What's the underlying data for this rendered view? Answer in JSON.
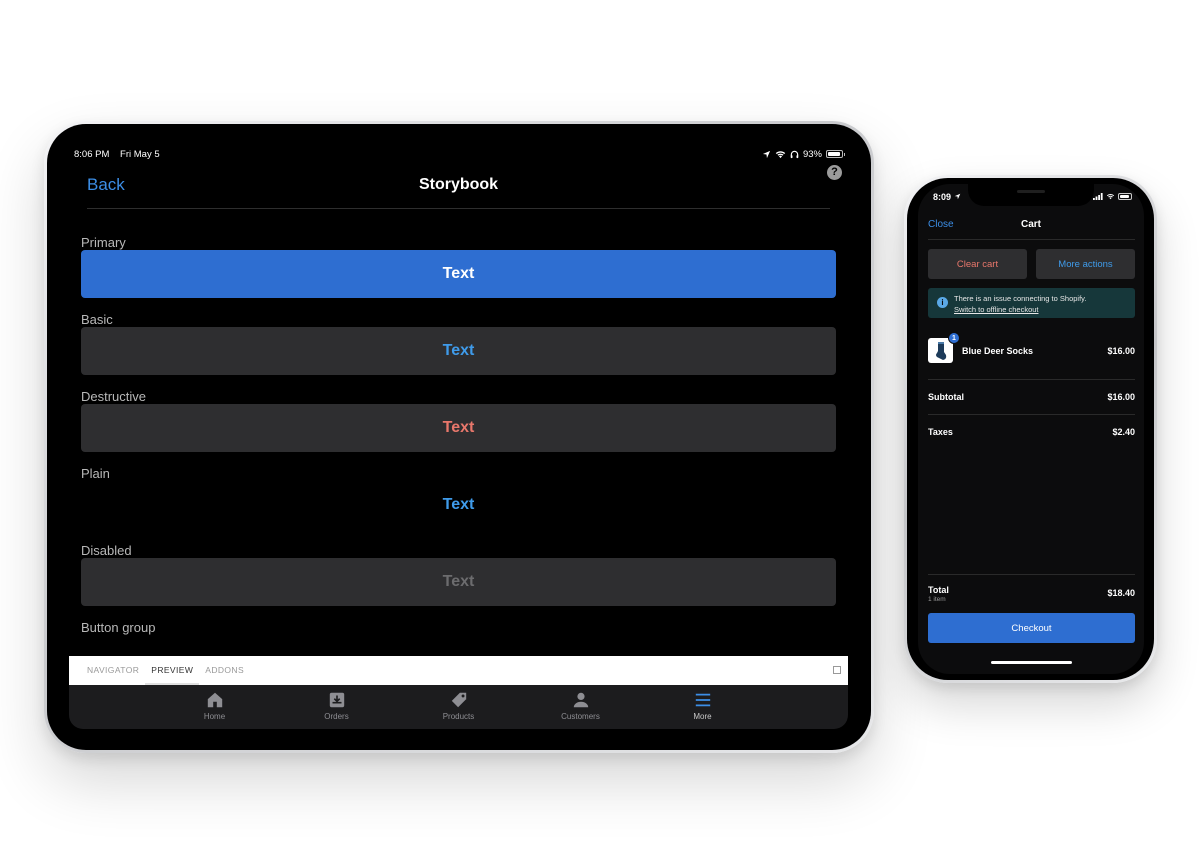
{
  "ipad": {
    "status": {
      "time": "8:06 PM",
      "date": "Fri May 5",
      "battery": "93%",
      "battery_level": 0.93
    },
    "nav": {
      "back_label": "Back",
      "title": "Storybook",
      "help_symbol": "?"
    },
    "sections": [
      {
        "label": "Primary",
        "button_text": "Text",
        "variant": "primary"
      },
      {
        "label": "Basic",
        "button_text": "Text",
        "variant": "basic"
      },
      {
        "label": "Destructive",
        "button_text": "Text",
        "variant": "destructive"
      },
      {
        "label": "Plain",
        "button_text": "Text",
        "variant": "plain"
      },
      {
        "label": "Disabled",
        "button_text": "Text",
        "variant": "disabled"
      }
    ],
    "button_group_label": "Button group",
    "storybook_tabs": [
      "NAVIGATOR",
      "PREVIEW",
      "ADDONS"
    ],
    "storybook_active_tab": "PREVIEW",
    "tabbar": [
      {
        "label": "Home",
        "icon": "home-icon"
      },
      {
        "label": "Orders",
        "icon": "orders-icon"
      },
      {
        "label": "Products",
        "icon": "tag-icon"
      },
      {
        "label": "Customers",
        "icon": "person-icon"
      },
      {
        "label": "More",
        "icon": "menu-icon"
      }
    ],
    "tabbar_active": "More"
  },
  "iphone": {
    "status": {
      "time": "8:09",
      "battery_level": 0.85
    },
    "nav": {
      "close_label": "Close",
      "title": "Cart"
    },
    "buttons": {
      "clear_cart": "Clear cart",
      "more_actions": "More actions"
    },
    "banner": {
      "message": "There is an issue connecting to Shopify.",
      "link": "Switch to offline checkout",
      "info_symbol": "i"
    },
    "line_item": {
      "quantity": "1",
      "name": "Blue Deer Socks",
      "price": "$16.00"
    },
    "summary": {
      "subtotal_label": "Subtotal",
      "subtotal_value": "$16.00",
      "taxes_label": "Taxes",
      "taxes_value": "$2.40"
    },
    "total": {
      "label": "Total",
      "count": "1 item",
      "value": "$18.40"
    },
    "checkout_label": "Checkout"
  },
  "colors": {
    "primary_blue": "#2e6ed1",
    "link_blue": "#3c8ee6",
    "destructive_red": "#e8776b",
    "surface": "#2e2e30",
    "banner_teal": "#16373a"
  }
}
